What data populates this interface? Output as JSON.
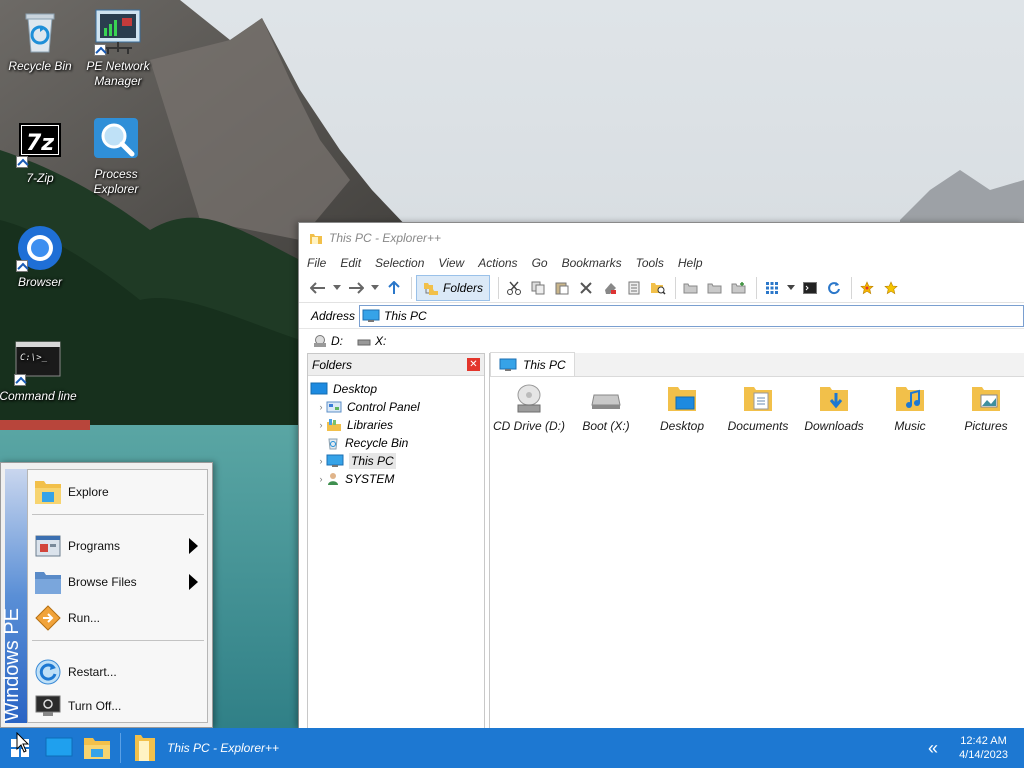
{
  "desktop": {
    "icons": [
      {
        "label": "Recycle Bin",
        "icon": "recycle-bin-icon"
      },
      {
        "label": "PE Network Manager",
        "icon": "network-manager-icon"
      },
      {
        "label": "7-Zip",
        "icon": "seven-zip-icon"
      },
      {
        "label": "Process Explorer",
        "icon": "process-explorer-icon"
      },
      {
        "label": "Browser",
        "icon": "browser-icon"
      },
      {
        "label": "Command line",
        "icon": "command-line-icon"
      }
    ]
  },
  "explorer": {
    "title": "This PC - Explorer++",
    "menu": [
      "File",
      "Edit",
      "Selection",
      "View",
      "Actions",
      "Go",
      "Bookmarks",
      "Tools",
      "Help"
    ],
    "toolbar": {
      "folders_label": "Folders"
    },
    "address": {
      "label": "Address",
      "value": "This PC"
    },
    "drives": [
      {
        "label": "D:"
      },
      {
        "label": "X:"
      }
    ],
    "folders_pane": {
      "title": "Folders",
      "tree": [
        {
          "label": "Desktop",
          "level": 0
        },
        {
          "label": "Control Panel",
          "level": 1
        },
        {
          "label": "Libraries",
          "level": 1
        },
        {
          "label": "Recycle Bin",
          "level": 1
        },
        {
          "label": "This PC",
          "level": 1,
          "selected": true
        },
        {
          "label": "SYSTEM",
          "level": 1
        }
      ]
    },
    "tab": {
      "label": "This PC"
    },
    "items": [
      {
        "label": "CD Drive (D:)",
        "icon": "cd-drive-icon"
      },
      {
        "label": "Boot (X:)",
        "icon": "hard-drive-icon"
      },
      {
        "label": "Desktop",
        "icon": "desktop-folder-icon"
      },
      {
        "label": "Documents",
        "icon": "documents-folder-icon"
      },
      {
        "label": "Downloads",
        "icon": "downloads-folder-icon"
      },
      {
        "label": "Music",
        "icon": "music-folder-icon"
      },
      {
        "label": "Pictures",
        "icon": "pictures-folder-icon"
      }
    ]
  },
  "start_menu": {
    "side_text": "Windows PE",
    "items": {
      "explore": "Explore",
      "programs": "Programs",
      "browse_files": "Browse Files",
      "run": "Run...",
      "restart": "Restart...",
      "turn_off": "Turn Off..."
    }
  },
  "taskbar": {
    "task_label": "This PC - Explorer++",
    "time": "12:42 AM",
    "date": "4/14/2023",
    "colors": {
      "taskbar": "#1d78d2",
      "accent": "#2a64c4"
    }
  }
}
